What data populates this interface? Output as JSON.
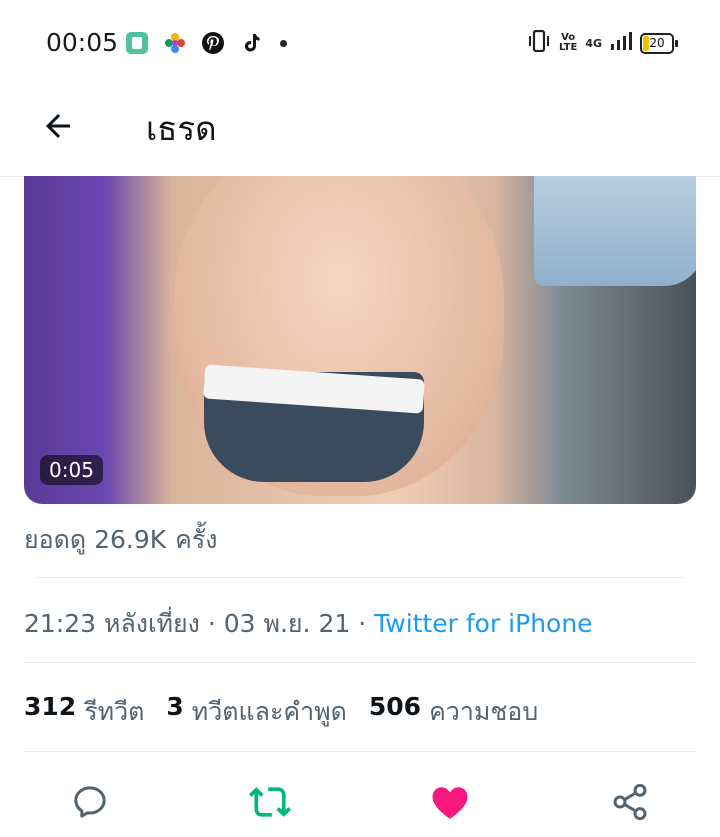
{
  "status_bar": {
    "time": "00:05",
    "app_icons": [
      "app-icon",
      "photos-icon",
      "pinterest-icon",
      "tiktok-icon"
    ],
    "volte_top": "Vo",
    "volte_bottom": "LTE",
    "network": "4G",
    "battery": "20",
    "colors": {
      "battery_fill": "#f2c200"
    }
  },
  "header": {
    "title": "เธรด",
    "back_icon": "arrow-left-icon"
  },
  "media": {
    "duration": "0:05"
  },
  "tweet": {
    "views_count": "ยอดดู 26.9K",
    "views_suffix": "ครั้ง",
    "time_date": "21:23 หลังเที่ยง · 03 พ.ย. 21 ·",
    "source": "Twitter for iPhone"
  },
  "stats": [
    {
      "num": "312",
      "label": "รีทวีต"
    },
    {
      "num": "3",
      "label": "ทวีตและคำพูด"
    },
    {
      "num": "506",
      "label": "ความชอบ"
    }
  ],
  "actions": {
    "icons": [
      "reply-icon",
      "retweet-icon",
      "like-icon",
      "share-icon"
    ],
    "colors": {
      "retweet": "#00ba7c",
      "like": "#f91880",
      "default": "#536471"
    }
  },
  "colors": {
    "link": "#1d9bf0",
    "secondary_text": "#536471"
  }
}
